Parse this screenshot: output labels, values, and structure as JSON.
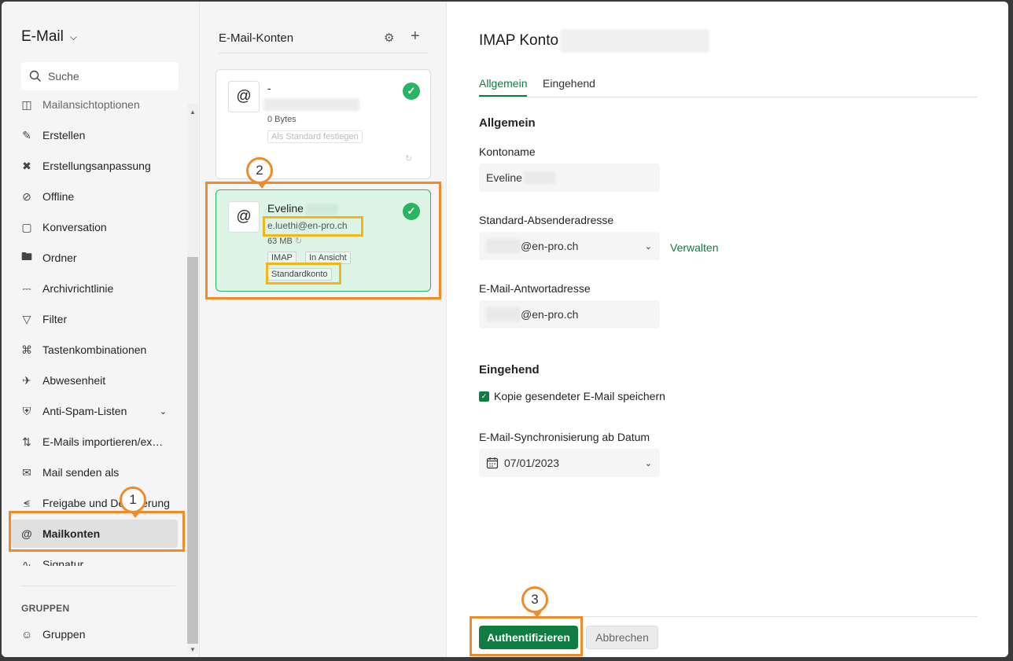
{
  "nav": {
    "app_title": "E-Mail",
    "search_placeholder": "Suche",
    "items": [
      {
        "label": "Mailansichtoptionen",
        "icon": "layout-icon"
      },
      {
        "label": "Erstellen",
        "icon": "compose-icon"
      },
      {
        "label": "Erstellungsanpassung",
        "icon": "customize-icon"
      },
      {
        "label": "Offline",
        "icon": "offline-icon"
      },
      {
        "label": "Konversation",
        "icon": "conversation-icon"
      },
      {
        "label": "Ordner",
        "icon": "folder-icon"
      },
      {
        "label": "Archivrichtlinie",
        "icon": "archive-icon"
      },
      {
        "label": "Filter",
        "icon": "filter-icon"
      },
      {
        "label": "Tastenkombinationen",
        "icon": "command-icon"
      },
      {
        "label": "Abwesenheit",
        "icon": "plane-icon"
      },
      {
        "label": "Anti-Spam-Listen",
        "icon": "shield-icon"
      },
      {
        "label": "E-Mails importieren/ex…",
        "icon": "import-export-icon"
      },
      {
        "label": "Mail senden als",
        "icon": "send-as-icon"
      },
      {
        "label": "Freigabe und Delegierung",
        "icon": "share-icon"
      },
      {
        "label": "Mailkonten",
        "icon": "at-icon"
      },
      {
        "label": "Signatur",
        "icon": "signature-icon"
      }
    ],
    "groups_heading": "GRUPPEN",
    "groups_item": "Gruppen"
  },
  "accounts": {
    "header": "E-Mail-Konten",
    "cards": [
      {
        "name": "-",
        "size": "0 Bytes",
        "set_default": "Als Standard festlegen"
      },
      {
        "name": "Eveline",
        "email": "e.luethi@en-pro.ch",
        "size": "63 MB",
        "tags": [
          "IMAP",
          "In Ansicht"
        ],
        "default_tag": "Standardkonto"
      }
    ]
  },
  "detail": {
    "title": "IMAP Konto",
    "tabs": [
      "Allgemein",
      "Eingehend"
    ],
    "section_general": "Allgemein",
    "account_name_label": "Kontoname",
    "account_name_value": "Eveline",
    "sender_label": "Standard-Absenderadresse",
    "sender_value": "@en-pro.ch",
    "manage_link": "Verwalten",
    "reply_label": "E-Mail-Antwortadresse",
    "reply_value": "@en-pro.ch",
    "section_incoming": "Eingehend",
    "copy_sent_label": "Kopie gesendeter E-Mail speichern",
    "copy_sent_checked": true,
    "sync_label": "E-Mail-Synchronisierung ab Datum",
    "sync_value": "07/01/2023",
    "auth_button": "Authentifizieren",
    "cancel_button": "Abbrechen"
  },
  "markers": [
    "1",
    "2",
    "3"
  ],
  "colors": {
    "accent": "#107c41",
    "highlight_orange": "#f18b2a",
    "highlight_yellow": "#f3b51b",
    "check_green": "#28b463"
  }
}
